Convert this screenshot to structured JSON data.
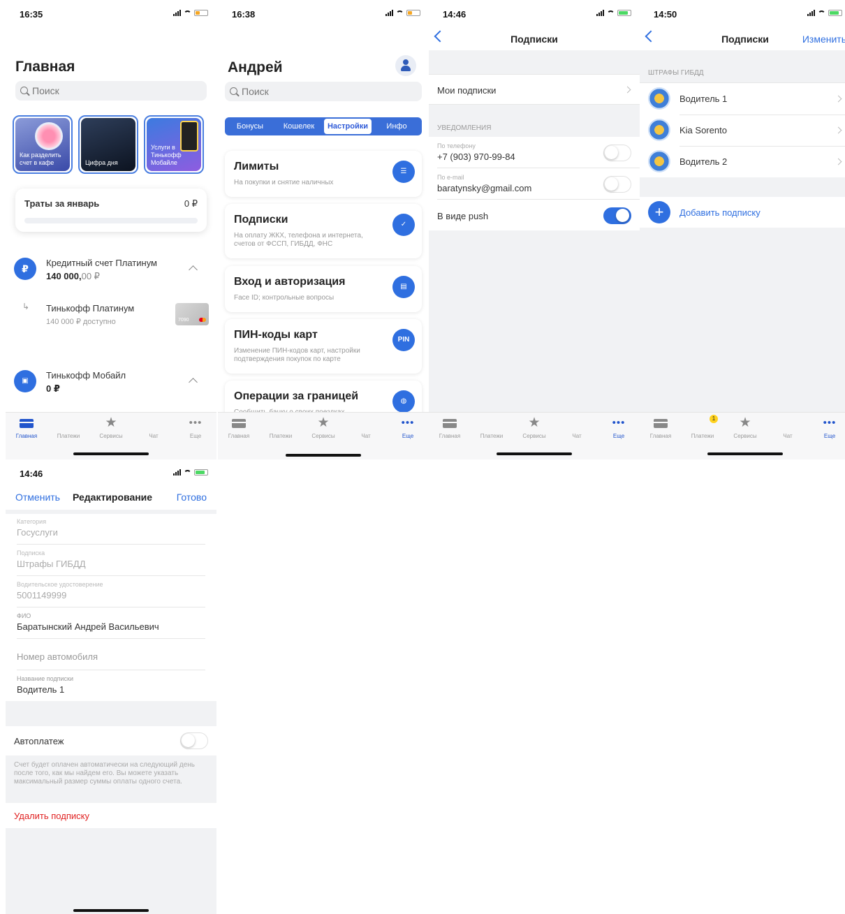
{
  "screen1": {
    "time": "16:35",
    "title": "Главная",
    "search_placeholder": "Поиск",
    "stories": [
      "Как разделить счет в кафе",
      "Цифра дня",
      "Услуги в Тинькофф Мобайле"
    ],
    "spend_label": "Траты за январь",
    "spend_value": "0 ₽",
    "credit_name": "Кредитный счет Платинум",
    "credit_amount": "140 000,",
    "credit_amount_cents": "00 ₽",
    "card_name": "Тинькофф Платинум",
    "card_available": "140 000 ₽ доступно",
    "card_last": "7090",
    "mobile_name": "Тинькофф Мобайл",
    "mobile_amount": "0 ₽"
  },
  "tabs": [
    "Главная",
    "Платежи",
    "Сервисы",
    "Чат",
    "Еще"
  ],
  "screen2": {
    "time": "16:38",
    "title": "Андрей",
    "search_placeholder": "Поиск",
    "segments": [
      "Бонусы",
      "Кошелек",
      "Настройки",
      "Инфо"
    ],
    "cards": [
      {
        "title": "Лимиты",
        "desc": "На покупки и снятие наличных"
      },
      {
        "title": "Подписки",
        "desc": "На оплату ЖКХ, телефона и интернета, счетов от ФССП, ГИБДД, ФНС"
      },
      {
        "title": "Вход и авторизация",
        "desc": "Face ID; контрольные вопросы"
      },
      {
        "title": "ПИН-коды карт",
        "desc": "Изменение ПИН-кодов карт, настройки подтверждения покупок по карте",
        "icon_text": "PIN"
      },
      {
        "title": "Операции за границей",
        "desc": "Сообщить банку о своих поездках"
      }
    ]
  },
  "screen3": {
    "time": "14:46",
    "title": "Подписки",
    "my_subs": "Мои подписки",
    "section": "УВЕДОМЛЕНИЯ",
    "phone_label": "По телефону",
    "phone_value": "+7 (903) 970-99-84",
    "email_label": "По e-mail",
    "email_value": "baratynsky@gmail.com",
    "push_label": "В виде push"
  },
  "screen4": {
    "time": "14:50",
    "title": "Подписки",
    "edit": "Изменить",
    "section": "ШТРАФЫ ГИБДД",
    "items": [
      "Водитель 1",
      "Kia Sorento",
      "Водитель 2"
    ],
    "add": "Добавить подписку",
    "badge": "1"
  },
  "screen5": {
    "time": "14:46",
    "cancel": "Отменить",
    "title": "Редактирование",
    "done": "Готово",
    "category_label": "Категория",
    "category_value": "Госуслуги",
    "sub_label": "Подписка",
    "sub_value": "Штрафы ГИБДД",
    "license_label": "Водительское удостоверение",
    "license_value": "5001149999",
    "fio_label": "ФИО",
    "fio_value": "Баратынский Андрей Васильевич",
    "car_placeholder": "Номер автомобиля",
    "name_label": "Название подписки",
    "name_value": "Водитель 1",
    "autopay": "Автоплатеж",
    "autopay_note": "Счет будет оплачен автоматически на следующий день после того, как мы найдем его. Вы можете указать максимальный размер суммы оплаты одного счета.",
    "delete": "Удалить подписку"
  },
  "colors": {
    "accent": "#2f6fe0",
    "danger": "#e02020",
    "toggle_on": "#2f6fe0"
  }
}
